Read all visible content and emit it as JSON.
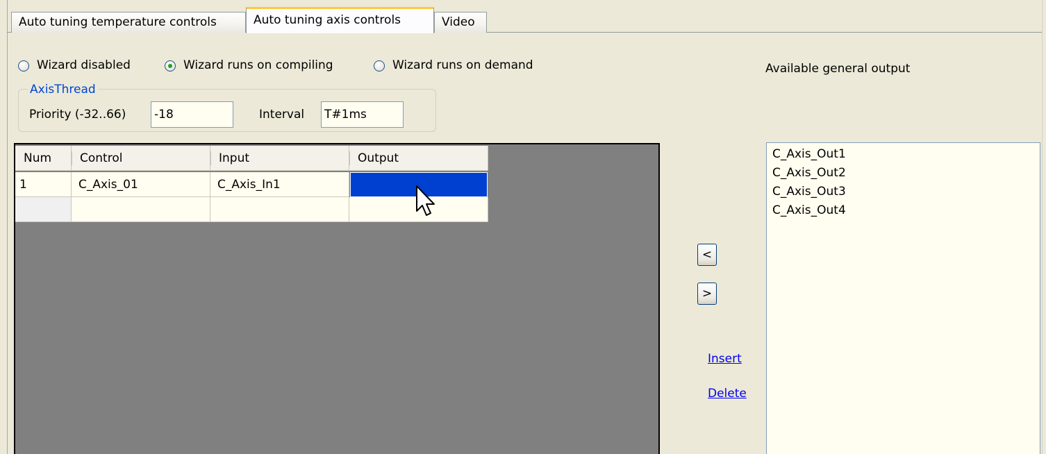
{
  "tabs": [
    {
      "label": "Auto tuning temperature controls",
      "active": false
    },
    {
      "label": "Auto tuning axis controls",
      "active": true
    },
    {
      "label": "Video",
      "active": false
    }
  ],
  "wizard": {
    "options": [
      {
        "label": "Wizard disabled",
        "checked": false
      },
      {
        "label": "Wizard runs on compiling",
        "checked": true
      },
      {
        "label": "Wizard runs on demand",
        "checked": false
      }
    ]
  },
  "axis_thread": {
    "title": "AxisThread",
    "priority_label": "Priority (-32..66)",
    "priority_value": "-18",
    "interval_label": "Interval",
    "interval_value": "T#1ms"
  },
  "grid": {
    "columns": [
      "Num",
      "Control",
      "Input",
      "Output"
    ],
    "rows": [
      {
        "num": "1",
        "control": "C_Axis_01",
        "input": "C_Axis_In1",
        "output": ""
      },
      {
        "num": "",
        "control": "",
        "input": "",
        "output": ""
      }
    ],
    "selected_cell": "output-row-1"
  },
  "buttons": {
    "move_left": "<",
    "move_right": ">",
    "insert": "Insert",
    "delete": "Delete"
  },
  "available_outputs": {
    "label": "Available general output",
    "items": [
      "C_Axis_Out1",
      "C_Axis_Out2",
      "C_Axis_Out3",
      "C_Axis_Out4"
    ]
  },
  "colors": {
    "selection": "#0040d0",
    "active_tab_accent": "#ffc83c",
    "group_title": "#0046d5",
    "link": "#0000ee",
    "grid_background": "#808080"
  },
  "icons": {
    "cursor": "arrow-cursor-icon",
    "radio": "radio-button-icon"
  }
}
